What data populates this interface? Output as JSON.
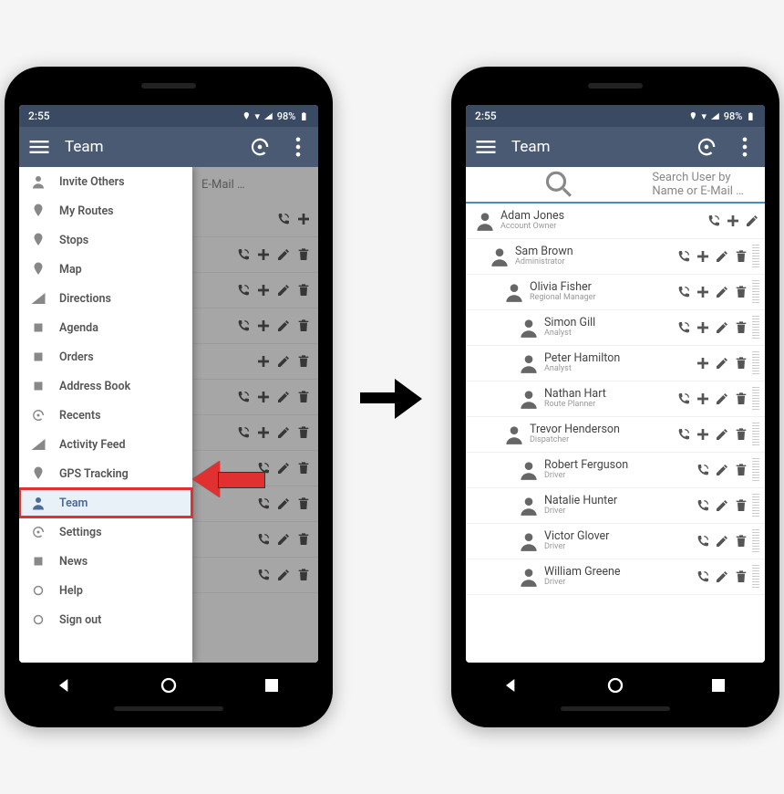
{
  "status": {
    "time": "2:55",
    "battery": "98%"
  },
  "appbar": {
    "title": "Team"
  },
  "search": {
    "placeholder": "Search User by Name or E-Mail …",
    "placeholder_short": "E-Mail …"
  },
  "drawer": {
    "items": [
      {
        "icon": "invite",
        "label": "Invite Others"
      },
      {
        "icon": "routes",
        "label": "My Routes"
      },
      {
        "icon": "stops",
        "label": "Stops"
      },
      {
        "icon": "map",
        "label": "Map"
      },
      {
        "icon": "directions",
        "label": "Directions"
      },
      {
        "icon": "agenda",
        "label": "Agenda"
      },
      {
        "icon": "orders",
        "label": "Orders"
      },
      {
        "icon": "addressbook",
        "label": "Address Book"
      },
      {
        "icon": "recents",
        "label": "Recents"
      },
      {
        "icon": "activity",
        "label": "Activity Feed"
      },
      {
        "icon": "gps",
        "label": "GPS Tracking"
      },
      {
        "icon": "team",
        "label": "Team",
        "selected": true
      },
      {
        "icon": "settings",
        "label": "Settings"
      },
      {
        "icon": "news",
        "label": "News"
      },
      {
        "icon": "help",
        "label": "Help"
      },
      {
        "icon": "signout",
        "label": "Sign out"
      }
    ]
  },
  "users": [
    {
      "name": "Adam Jones",
      "role": "Account Owner",
      "indent": 0,
      "actions": [
        "call",
        "plus",
        "edit"
      ]
    },
    {
      "name": "Sam Brown",
      "role": "Administrator",
      "indent": 1,
      "actions": [
        "call",
        "plus",
        "edit",
        "delete"
      ],
      "handle": true
    },
    {
      "name": "Olivia Fisher",
      "role": "Regional Manager",
      "indent": 2,
      "actions": [
        "call",
        "plus",
        "edit",
        "delete"
      ],
      "handle": true
    },
    {
      "name": "Simon Gill",
      "role": "Analyst",
      "indent": 3,
      "actions": [
        "call",
        "plus",
        "edit",
        "delete"
      ],
      "handle": true
    },
    {
      "name": "Peter Hamilton",
      "role": "Analyst",
      "indent": 3,
      "actions": [
        "plus",
        "edit",
        "delete"
      ],
      "handle": true
    },
    {
      "name": "Nathan Hart",
      "role": "Route Planner",
      "indent": 3,
      "actions": [
        "call",
        "plus",
        "edit",
        "delete"
      ],
      "handle": true
    },
    {
      "name": "Trevor Henderson",
      "role": "Dispatcher",
      "indent": 2,
      "actions": [
        "call",
        "plus",
        "edit",
        "delete"
      ],
      "handle": true
    },
    {
      "name": "Robert Ferguson",
      "role": "Driver",
      "indent": 3,
      "actions": [
        "call",
        "edit",
        "delete"
      ],
      "handle": true
    },
    {
      "name": "Natalie Hunter",
      "role": "Driver",
      "indent": 3,
      "actions": [
        "call",
        "edit",
        "delete"
      ],
      "handle": true
    },
    {
      "name": "Victor Glover",
      "role": "Driver",
      "indent": 3,
      "actions": [
        "call",
        "edit",
        "delete"
      ],
      "handle": true
    },
    {
      "name": "William Greene",
      "role": "Driver",
      "indent": 3,
      "actions": [
        "call",
        "edit",
        "delete"
      ],
      "handle": true
    }
  ],
  "bg_rows": [
    [
      "call",
      "plus"
    ],
    [
      "call",
      "plus",
      "edit",
      "delete"
    ],
    [
      "call",
      "plus",
      "edit",
      "delete"
    ],
    [
      "call",
      "plus",
      "edit",
      "delete"
    ],
    [
      "plus",
      "edit",
      "delete"
    ],
    [
      "call",
      "plus",
      "edit",
      "delete"
    ],
    [
      "call",
      "plus",
      "edit",
      "delete"
    ],
    [
      "call",
      "edit",
      "delete"
    ],
    [
      "call",
      "edit",
      "delete"
    ],
    [
      "call",
      "edit",
      "delete"
    ],
    [
      "call",
      "edit",
      "delete"
    ]
  ]
}
